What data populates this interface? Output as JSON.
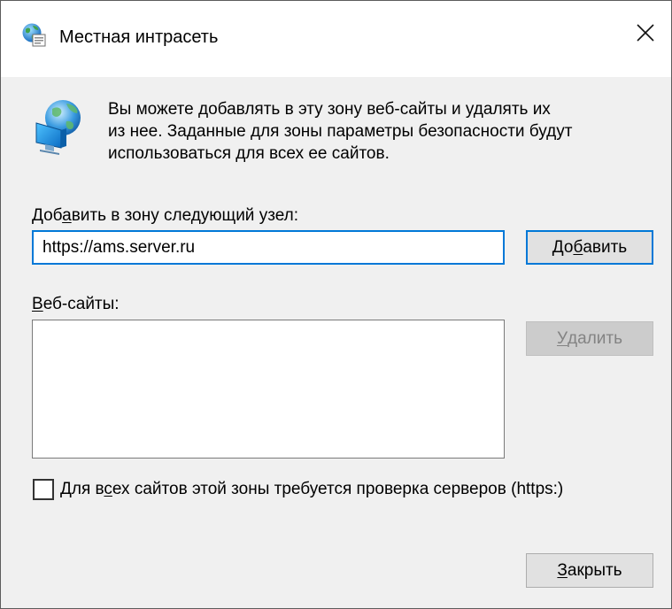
{
  "window": {
    "title": "Местная интрасеть",
    "close_glyph": "✕",
    "title_icon": "intranet-globe-icon"
  },
  "description": {
    "icon": "globe-monitor-icon",
    "text": "Вы можете добавлять в эту зону  веб-сайты и удалять их\nиз нее. Заданные для зоны параметры безопасности будут\nиспользоваться для всех ее сайтов."
  },
  "add_site": {
    "label_before": "Доб",
    "label_mnemonic": "а",
    "label_after": "вить в зону следующий узел:",
    "input_value": "https://ams.server.ru",
    "button_before": "До",
    "button_mnemonic": "б",
    "button_after": "авить"
  },
  "websites": {
    "label_mnemonic": "В",
    "label_after": "еб-сайты:",
    "items": [],
    "remove_before": "",
    "remove_mnemonic": "У",
    "remove_after": "далить",
    "remove_enabled": false
  },
  "https_check": {
    "label_before": "Для в",
    "label_mnemonic": "с",
    "label_after": "ех сайтов этой зоны требуется проверка серверов (https:)",
    "checked": false
  },
  "close_button": {
    "before": "",
    "mnemonic": "З",
    "after": "акрыть"
  },
  "colors": {
    "focus_border": "#0078d7",
    "dialog_bg": "#f0f0f0",
    "disabled_text": "#838383"
  }
}
